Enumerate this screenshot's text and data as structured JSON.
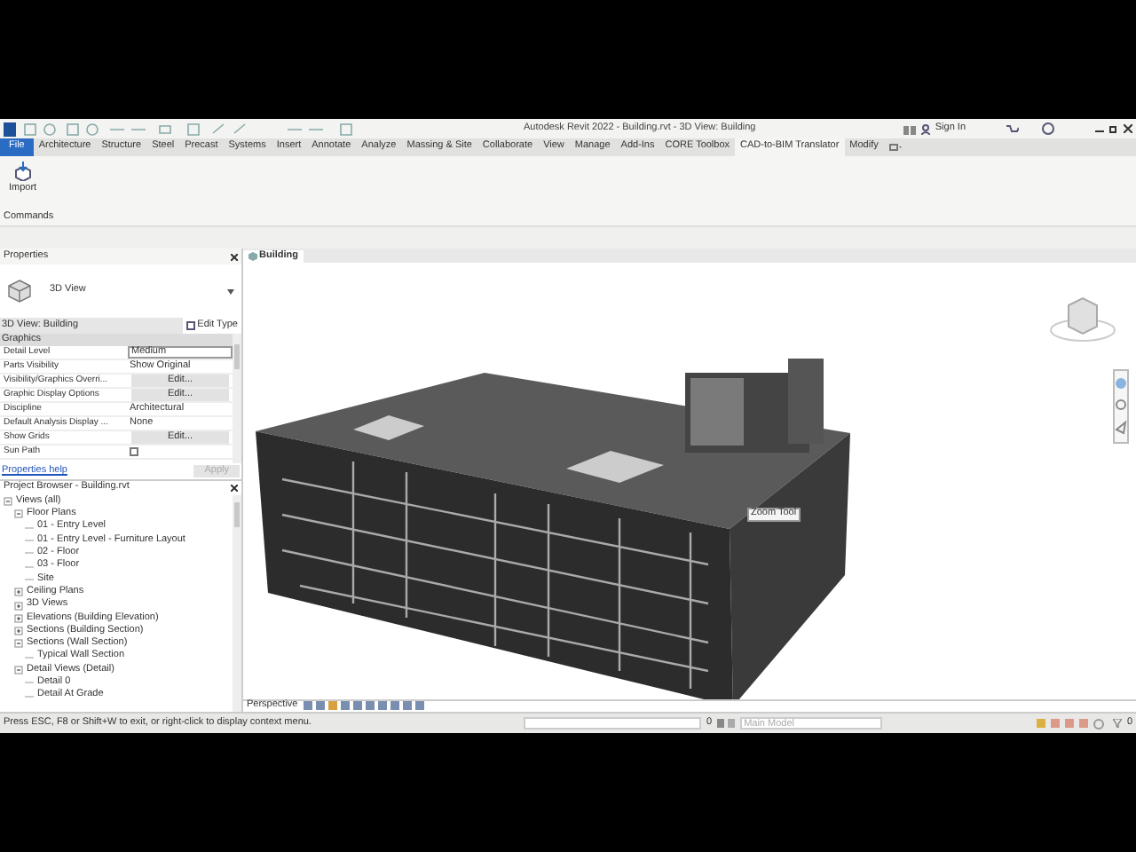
{
  "window": {
    "title": "Autodesk Revit 2022 - Building.rvt - 3D View: Building",
    "sign_in": "Sign In"
  },
  "ribbon": {
    "tabs": [
      {
        "label": "File",
        "kind": "file",
        "selected": false
      },
      {
        "label": "Architecture",
        "kind": "tab",
        "selected": false
      },
      {
        "label": "Structure",
        "kind": "tab",
        "selected": false
      },
      {
        "label": "Steel",
        "kind": "tab",
        "selected": false
      },
      {
        "label": "Precast",
        "kind": "tab",
        "selected": false
      },
      {
        "label": "Systems",
        "kind": "tab",
        "selected": false
      },
      {
        "label": "Insert",
        "kind": "tab",
        "selected": false
      },
      {
        "label": "Annotate",
        "kind": "tab",
        "selected": false
      },
      {
        "label": "Analyze",
        "kind": "tab",
        "selected": false
      },
      {
        "label": "Massing & Site",
        "kind": "tab",
        "selected": false
      },
      {
        "label": "Collaborate",
        "kind": "tab",
        "selected": false
      },
      {
        "label": "View",
        "kind": "tab",
        "selected": false
      },
      {
        "label": "Manage",
        "kind": "tab",
        "selected": false
      },
      {
        "label": "Add-Ins",
        "kind": "tab",
        "selected": false
      },
      {
        "label": "CORE Toolbox",
        "kind": "tab",
        "selected": false
      },
      {
        "label": "CAD-to-BIM Translator",
        "kind": "tab",
        "selected": true
      },
      {
        "label": "Modify",
        "kind": "tab",
        "selected": false
      }
    ],
    "buttons": [
      {
        "label": "Import"
      }
    ],
    "panel_label": "Commands"
  },
  "properties": {
    "title": "Properties",
    "type_name": "3D View",
    "selector": "3D View: Building",
    "edit_type": "Edit Type",
    "section": "Graphics",
    "rows": [
      {
        "label": "Detail Level",
        "kind": "field",
        "value": "Medium"
      },
      {
        "label": "Parts Visibility",
        "kind": "text",
        "value": "Show Original"
      },
      {
        "label": "Visibility/Graphics Overri...",
        "kind": "button",
        "value": "Edit..."
      },
      {
        "label": "Graphic Display Options",
        "kind": "button",
        "value": "Edit..."
      },
      {
        "label": "Discipline",
        "kind": "text",
        "value": "Architectural"
      },
      {
        "label": "Default Analysis Display ...",
        "kind": "text",
        "value": "None"
      },
      {
        "label": "Show Grids",
        "kind": "button",
        "value": "Edit..."
      },
      {
        "label": "Sun Path",
        "kind": "checkbox",
        "checked": false
      }
    ],
    "help": "Properties help",
    "apply": "Apply"
  },
  "browser": {
    "title": "Project Browser - Building.rvt",
    "tree": [
      {
        "label": "Views (all)",
        "expanded": true,
        "children": [
          {
            "label": "Floor Plans",
            "expanded": true,
            "children": [
              {
                "label": "01 - Entry Level"
              },
              {
                "label": "01 - Entry Level - Furniture Layout"
              },
              {
                "label": "02 - Floor"
              },
              {
                "label": "03 - Floor"
              },
              {
                "label": "Site"
              }
            ]
          },
          {
            "label": "Ceiling Plans",
            "expanded": false
          },
          {
            "label": "3D Views",
            "expanded": false
          },
          {
            "label": "Elevations (Building Elevation)",
            "expanded": false
          },
          {
            "label": "Sections (Building Section)",
            "expanded": false
          },
          {
            "label": "Sections (Wall Section)",
            "expanded": true,
            "children": [
              {
                "label": "Typical Wall Section"
              }
            ]
          },
          {
            "label": "Detail Views (Detail)",
            "expanded": true,
            "children": [
              {
                "label": "Detail 0"
              },
              {
                "label": "Detail At Grade"
              }
            ]
          }
        ]
      }
    ]
  },
  "view": {
    "tab": "Building",
    "tooltip": "Zoom Tool",
    "view_bar": "Perspective"
  },
  "status_bar": {
    "message": "Press ESC, F8 or Shift+W to exit, or right-click to display context menu.",
    "workset_count": "0",
    "model_placeholder": "Main Model",
    "filter_count": "0"
  }
}
